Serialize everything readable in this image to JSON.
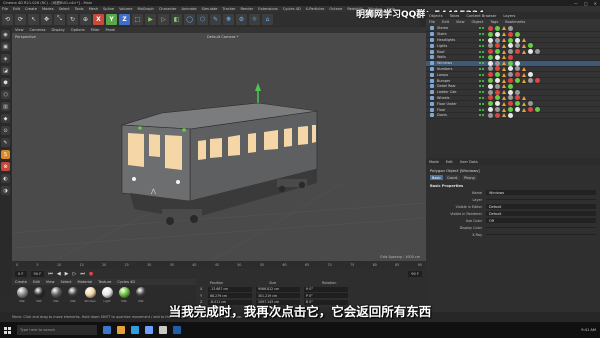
{
  "window": {
    "title": "Cinema 4D R21.026 (RC) - [地铁BUG.c4d *] - Main",
    "controls": [
      "—",
      "□",
      "✕"
    ]
  },
  "menubar": [
    "File",
    "Edit",
    "Create",
    "Modes",
    "Select",
    "Tools",
    "Mesh",
    "Spline",
    "Volume",
    "MoGraph",
    "Character",
    "Animate",
    "Simulate",
    "Tracker",
    "Render",
    "Extensions",
    "Cycles 4D",
    "X-Particles",
    "Octane",
    "RedshiftI",
    "Window",
    "Help"
  ],
  "watermark": {
    "text": "明狮网学习QQ群：54415334"
  },
  "toolbar": {
    "icons": [
      "undo",
      "redo",
      "pointer",
      "move",
      "scale",
      "rotate",
      "recent"
    ],
    "axes": {
      "x": "X",
      "y": "Y",
      "z": "Z"
    },
    "tool_glyphs": [
      "⟲",
      "⟳",
      "↖",
      "✥",
      "⤡",
      "↻",
      "⊕",
      "X",
      "Y",
      "Z",
      "⬚",
      "▶",
      "▷",
      "◧",
      "◯",
      "⬡",
      "✎",
      "❋",
      "⚙",
      "☼",
      "⌂"
    ]
  },
  "left_tools": [
    "◉",
    "▣",
    "◈",
    "◪",
    "⬢",
    "⬡",
    "▥",
    "◆",
    "⊙",
    "✎",
    "S",
    "⊗",
    "◐",
    "◑"
  ],
  "viewport": {
    "menu": [
      "View",
      "Cameras",
      "Display",
      "Options",
      "Filter",
      "Panel"
    ],
    "label": "Perspective",
    "camera": "Default Camera *",
    "grid_spacing": "Grid Spacing : 1000 cm"
  },
  "timeline": {
    "ticks": [
      "0",
      "5",
      "10",
      "15",
      "20",
      "25",
      "30",
      "35",
      "40",
      "45",
      "50",
      "55",
      "60",
      "65",
      "70",
      "75",
      "80",
      "85",
      "90"
    ],
    "start": "0 F",
    "current": "90 F",
    "end": "90 F"
  },
  "material_manager": {
    "menu": [
      "Create",
      "Edit",
      "View",
      "Select",
      "Material",
      "Texture",
      "Cycles 4D"
    ],
    "materials": [
      {
        "name": "Mat",
        "color": "#8a8a8a"
      },
      {
        "name": "Mat",
        "color": "#2a2a2a"
      },
      {
        "name": "Mat",
        "color": "#5e5e5e"
      },
      {
        "name": "Mat",
        "color": "#3c3c3c"
      },
      {
        "name": "Window",
        "color": "#f0d6a8"
      },
      {
        "name": "Light",
        "color": "#e8e8e8"
      },
      {
        "name": "Mat",
        "color": "#6cbf3c"
      },
      {
        "name": "Mat",
        "color": "#3a3a3a"
      }
    ]
  },
  "coordinates": {
    "headers": [
      "Position",
      "Size",
      "Rotation"
    ],
    "rows": [
      {
        "axis": "X",
        "pos": "-13.687 cm",
        "size": "9566.812 cm",
        "rot": "H  0°"
      },
      {
        "axis": "Y",
        "pos": "68.279 cm",
        "size": "301.219 cm",
        "rot": "P  0°"
      },
      {
        "axis": "Z",
        "pos": "-6.011 cm",
        "size": "1097.143 cm",
        "rot": "B  0°"
      }
    ]
  },
  "object_manager": {
    "tabs": [
      "Objects",
      "Takes",
      "Content Browser",
      "Layers"
    ],
    "menu": [
      "File",
      "Edit",
      "View",
      "Object",
      "Tags",
      "Bookmarks"
    ],
    "objects": [
      {
        "name": "Stereo",
        "color": "#7da7d9"
      },
      {
        "name": "Stairs",
        "color": "#7da7d9"
      },
      {
        "name": "Headlights",
        "color": "#7da7d9"
      },
      {
        "name": "Lights",
        "color": "#7da7d9"
      },
      {
        "name": "Roof",
        "color": "#7da7d9"
      },
      {
        "name": "Walls",
        "color": "#7da7d9"
      },
      {
        "name": "Windows",
        "color": "#7da7d9"
      },
      {
        "name": "Numbers",
        "color": "#7da7d9"
      },
      {
        "name": "Lamps",
        "color": "#7da7d9"
      },
      {
        "name": "Bumper",
        "color": "#7da7d9"
      },
      {
        "name": "Detail Rear",
        "color": "#7da7d9"
      },
      {
        "name": "Ladder Cab",
        "color": "#7da7d9"
      },
      {
        "name": "Wheels",
        "color": "#7da7d9"
      },
      {
        "name": "Floor Under",
        "color": "#7da7d9"
      },
      {
        "name": "Floor",
        "color": "#7da7d9"
      },
      {
        "name": "Doors",
        "color": "#7da7d9"
      }
    ],
    "tag_colors": [
      "#d44",
      "#6c4",
      "#e8e8e8",
      "#999"
    ]
  },
  "attribute_manager": {
    "tabs": [
      "Mode",
      "Edit",
      "User Data"
    ],
    "title": "Polygon Object [Windows]",
    "subtabs": [
      "Basic",
      "Coord.",
      "Phong"
    ],
    "section": "Basic Properties",
    "properties": [
      {
        "label": "Name",
        "value": "Windows"
      },
      {
        "label": "Layer",
        "value": ""
      },
      {
        "label": "Visible in Editor",
        "value": "Default"
      },
      {
        "label": "Visible in Renderer",
        "value": "Default"
      },
      {
        "label": "Use Color",
        "value": "Off"
      },
      {
        "label": "Display Color",
        "value": ""
      },
      {
        "label": "X-Ray",
        "value": ""
      }
    ]
  },
  "statusbar": {
    "text": "Move: Click and drag to move elements. Hold down SHIFT to quantize movement / add to the selection in point mode, CTRL to remove."
  },
  "subtitle": {
    "text": "当我完成时，我再次点击它，它会返回所有东西"
  },
  "taskbar": {
    "search_placeholder": "Type here to search",
    "app_colors": [
      "#3a78c8",
      "#e8a23a",
      "#2f9fe0",
      "#6aa0ff",
      "#c9c9c9",
      "#1e5fa8"
    ],
    "clock": "9:41 AM"
  }
}
